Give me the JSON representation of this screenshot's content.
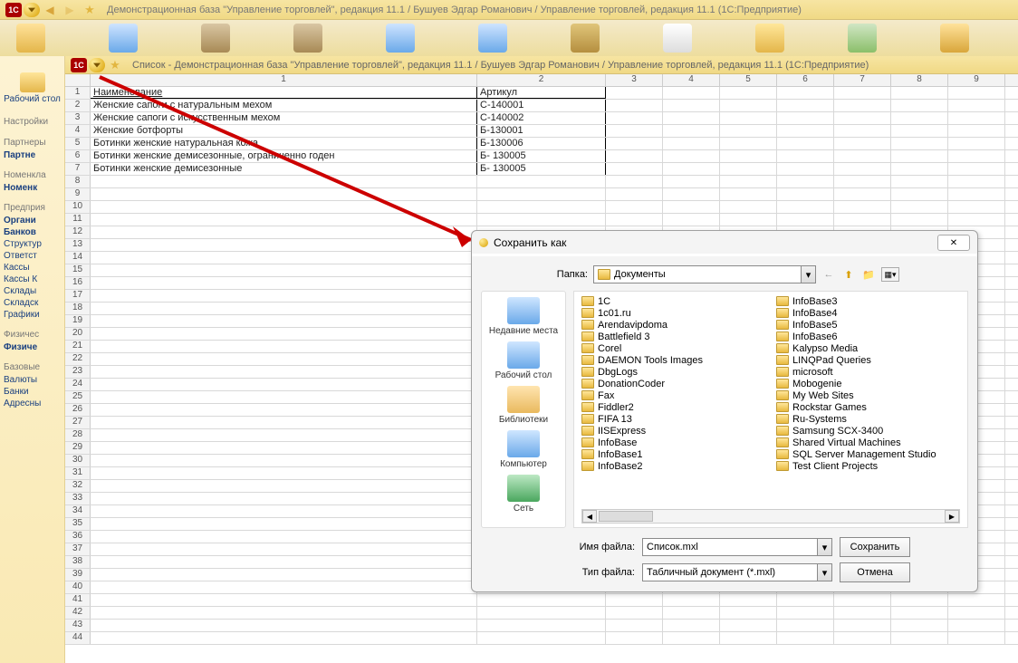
{
  "titlebar": {
    "text": "Демонстрационная база \"Управление торговлей\", редакция 11.1 / Бушуев Эдгар Романович / Управление торговлей, редакция 11.1  (1С:Предприятие)"
  },
  "inner_title": {
    "text": "Список - Демонстрационная база \"Управление торговлей\", редакция 11.1 / Бушуев Эдгар Романович / Управление торговлей, редакция 11.1  (1С:Предприятие)"
  },
  "sidebar": {
    "desktop": "Рабочий стол",
    "groups": [
      {
        "label": "Настройки",
        "items": []
      },
      {
        "label": "Партнеры",
        "items": [
          {
            "t": "Партне",
            "b": true
          }
        ]
      },
      {
        "label": "Номенкла",
        "items": [
          {
            "t": "Номенк",
            "b": true
          }
        ]
      },
      {
        "label": "Предприя",
        "items": [
          {
            "t": "Органи",
            "b": true
          },
          {
            "t": "Банков",
            "b": true
          },
          {
            "t": "Структур",
            "b": false
          },
          {
            "t": "Ответст",
            "b": false
          },
          {
            "t": "Кассы",
            "b": false
          },
          {
            "t": "Кассы К",
            "b": false
          },
          {
            "t": "Склады",
            "b": false
          },
          {
            "t": "Складск",
            "b": false
          },
          {
            "t": "Графики",
            "b": false
          }
        ]
      },
      {
        "label": "Физичес",
        "items": [
          {
            "t": "Физиче",
            "b": true
          }
        ]
      },
      {
        "label": "Базовые",
        "items": [
          {
            "t": "Валюты",
            "b": false
          },
          {
            "t": "Банки",
            "b": false
          },
          {
            "t": "Адресны",
            "b": false
          }
        ]
      }
    ]
  },
  "sheet": {
    "col_nums": [
      "1",
      "2",
      "3",
      "4",
      "5",
      "6",
      "7",
      "8",
      "9"
    ],
    "headers": {
      "c1": "Наименование",
      "c2": "Артикул"
    },
    "rows": [
      {
        "n": "2",
        "c1": "Женские сапоги с натуральным мехом",
        "c2": "С-140001"
      },
      {
        "n": "3",
        "c1": "Женские сапоги с искусственным мехом",
        "c2": "С-140002"
      },
      {
        "n": "4",
        "c1": "Женские ботфорты",
        "c2": "Б-130001"
      },
      {
        "n": "5",
        "c1": "Ботинки женские натуральная кожа",
        "c2": "Б-130006"
      },
      {
        "n": "6",
        "c1": "Ботинки женские демисезонные, ограниченно годен",
        "c2": "Б- 130005"
      },
      {
        "n": "7",
        "c1": "Ботинки женские демисезонные",
        "c2": "Б- 130005"
      }
    ],
    "empty_rows": [
      "8",
      "9",
      "10",
      "11",
      "12",
      "13",
      "14",
      "15",
      "16",
      "17",
      "18",
      "19",
      "20",
      "21",
      "22",
      "23",
      "24",
      "25",
      "26",
      "27",
      "28",
      "29",
      "30",
      "31",
      "32",
      "33",
      "34",
      "35",
      "36",
      "37",
      "38",
      "39",
      "40",
      "41",
      "42",
      "43",
      "44"
    ]
  },
  "dialog": {
    "title": "Сохранить как",
    "close": "✕",
    "folder_label": "Папка:",
    "folder_value": "Документы",
    "places": [
      {
        "label": "Недавние места",
        "color": "linear-gradient(#cfe6ff,#6aa9e9)"
      },
      {
        "label": "Рабочий стол",
        "color": "linear-gradient(#cfe6ff,#6aa9e9)"
      },
      {
        "label": "Библиотеки",
        "color": "linear-gradient(#ffe5b0,#e9b95e)"
      },
      {
        "label": "Компьютер",
        "color": "linear-gradient(#cfe6ff,#6aa9e9)"
      },
      {
        "label": "Сеть",
        "color": "linear-gradient(#bde8c4,#4aa75e)"
      }
    ],
    "files_col1": [
      "1C",
      "1c01.ru",
      "Arendavipdoma",
      "Battlefield 3",
      "Corel",
      "DAEMON Tools Images",
      "DbgLogs",
      "DonationCoder",
      "Fax",
      "Fiddler2",
      "FIFA 13",
      "IISExpress",
      "InfoBase",
      "InfoBase1",
      "InfoBase2"
    ],
    "files_col2": [
      "InfoBase3",
      "InfoBase4",
      "InfoBase5",
      "InfoBase6",
      "Kalypso Media",
      "LINQPad Queries",
      "microsoft",
      "Mobogenie",
      "My Web Sites",
      "Rockstar Games",
      "Ru-Systems",
      "Samsung SCX-3400",
      "Shared Virtual Machines",
      "SQL Server Management Studio",
      "Test Client Projects"
    ],
    "filename_label": "Имя файла:",
    "filename_value": "Список.mxl",
    "type_label": "Тип файла:",
    "type_value": "Табличный документ (*.mxl)",
    "save_btn": "Сохранить",
    "cancel_btn": "Отмена"
  }
}
